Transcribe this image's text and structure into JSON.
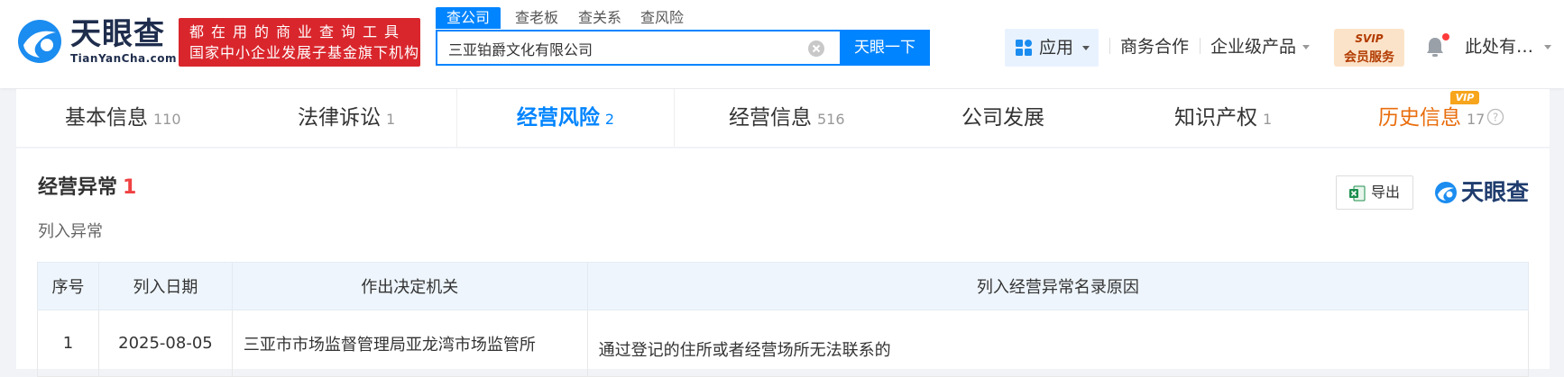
{
  "header": {
    "logo_text": "天眼查",
    "logo_sub": "TianYanCha.com",
    "slogan_line1": "都在用的商业查询工具",
    "slogan_line2": "国家中小企业发展子基金旗下机构"
  },
  "search": {
    "tabs": [
      "查公司",
      "查老板",
      "查关系",
      "查风险"
    ],
    "value": "三亚铂爵文化有限公司",
    "button_label": "天眼一下"
  },
  "nav": {
    "apps_label": "应用",
    "business": "商务合作",
    "enterprise": "企业级产品",
    "svip_line1": "SVIP",
    "svip_line2": "会员服务",
    "user": "此处有…"
  },
  "tabs": [
    {
      "label": "基本信息",
      "count": "110"
    },
    {
      "label": "法律诉讼",
      "count": "1"
    },
    {
      "label": "经营风险",
      "count": "2"
    },
    {
      "label": "经营信息",
      "count": "516"
    },
    {
      "label": "公司发展",
      "count": ""
    },
    {
      "label": "知识产权",
      "count": "1"
    },
    {
      "label": "历史信息",
      "count": "17"
    }
  ],
  "vip_badge": "VIP",
  "section": {
    "title": "经营异常",
    "count": "1",
    "sub_label": "列入异常",
    "export_label": "导出",
    "watermark": "天眼查"
  },
  "table": {
    "headers": [
      "序号",
      "列入日期",
      "作出决定机关",
      "列入经营异常名录原因"
    ],
    "rows": [
      {
        "no": "1",
        "date": "2025-08-05",
        "org": "三亚市市场监督管理局亚龙湾市场监管所",
        "reason": "通过登记的住所或者经营场所无法联系的"
      }
    ]
  },
  "colors": {
    "primary": "#0084ff",
    "slogan_bg": "#d9262c",
    "count_red": "#f04142",
    "vip_orange": "#e96d0c"
  }
}
